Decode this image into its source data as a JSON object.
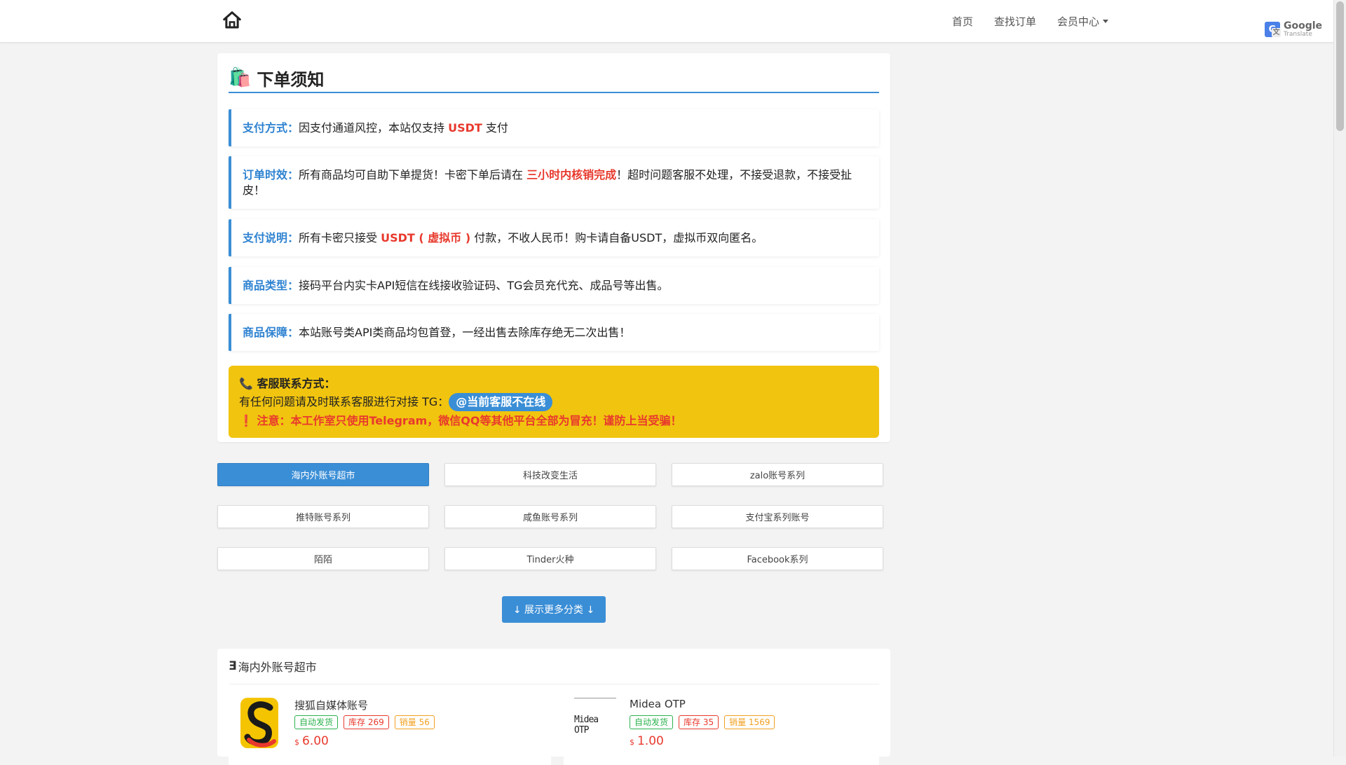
{
  "nav": {
    "home_icon": "home-icon",
    "links": [
      {
        "label": "首页"
      },
      {
        "label": "查找订单"
      },
      {
        "label": "会员中心"
      }
    ],
    "google_translate": {
      "brand": "Google",
      "sub": "Translate"
    }
  },
  "notice": {
    "title": "下单须知",
    "items": [
      {
        "label": "支付方式：",
        "pre": "因支付通道风控，本站仅支持 ",
        "highlight": "USDT",
        "post": " 支付"
      },
      {
        "label": "订单时效：",
        "pre": "所有商品均可自助下单提货！卡密下单后请在 ",
        "highlight": "三小时内核销完成",
        "post": "！超时问题客服不处理，不接受退款，不接受扯皮！"
      },
      {
        "label": "支付说明：",
        "pre": "所有卡密只接受 ",
        "highlight": "USDT ( 虚拟币 )",
        "post": " 付款，不收人民币！购卡请自备USDT，虚拟币双向匿名。"
      },
      {
        "label": "商品类型：",
        "pre": "接码平台内实卡API短信在线接收验证码、TG会员充代充、成品号等出售。",
        "highlight": "",
        "post": ""
      },
      {
        "label": "商品保障：",
        "pre": "本站账号类API类商品均包首登，一经出售去除库存绝无二次出售！",
        "highlight": "",
        "post": ""
      }
    ],
    "contact": {
      "title": "客服联系方式：",
      "text": "有任何问题请及时联系客服进行对接 TG：",
      "tg_button": "@当前客服不在线",
      "warning": "注意：本工作室只使用Telegram，微信QQ等其他平台全部为冒充！谨防上当受骗！"
    }
  },
  "categories": [
    {
      "label": "海内外账号超市",
      "active": true
    },
    {
      "label": "科技改变生活",
      "active": false
    },
    {
      "label": "zalo账号系列",
      "active": false
    },
    {
      "label": "推特账号系列",
      "active": false
    },
    {
      "label": "咸鱼账号系列",
      "active": false
    },
    {
      "label": "支付宝系列账号",
      "active": false
    },
    {
      "label": "陌陌",
      "active": false
    },
    {
      "label": "Tinder火种",
      "active": false
    },
    {
      "label": "Facebook系列",
      "active": false
    }
  ],
  "more_button": "↓ 展示更多分类 ↓",
  "products_section": {
    "title": "海内外账号超市",
    "items": [
      {
        "name": "搜狐自媒体账号",
        "auto": "自动发货",
        "stock": "库存 269",
        "sales": "销量 56",
        "currency": "$",
        "price": "6.00",
        "thumb": "sohu-logo"
      },
      {
        "name": "Midea OTP",
        "auto": "自动发货",
        "stock": "库存 35",
        "sales": "销量 1569",
        "currency": "$",
        "price": "1.00",
        "thumb": "midea-otp-logo",
        "thumb_text": "Midea OTP"
      }
    ]
  },
  "colors": {
    "accent": "#3a8ed6",
    "warning_bg": "#f1c40f",
    "red": "#e8392d"
  }
}
